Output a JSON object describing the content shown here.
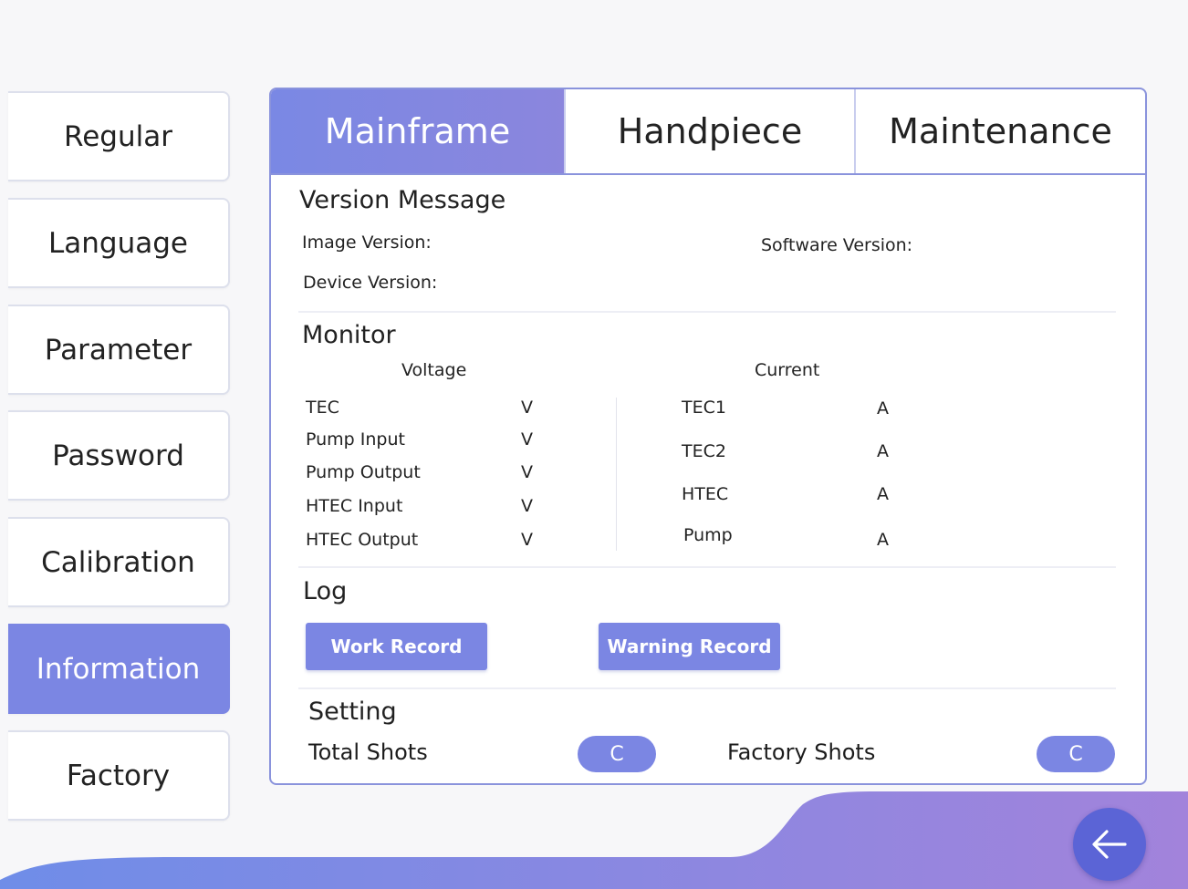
{
  "sidebar": {
    "items": [
      {
        "label": "Regular"
      },
      {
        "label": "Language"
      },
      {
        "label": "Parameter"
      },
      {
        "label": "Password"
      },
      {
        "label": "Calibration"
      },
      {
        "label": "Information"
      },
      {
        "label": "Factory"
      }
    ],
    "active": "Information"
  },
  "tabs": [
    {
      "label": "Mainframe"
    },
    {
      "label": "Handpiece"
    },
    {
      "label": "Maintenance"
    }
  ],
  "version": {
    "title": "Version Message",
    "image_label": "Image Version:",
    "software_label": "Software Version:",
    "device_label": "Device Version:"
  },
  "monitor": {
    "title": "Monitor",
    "voltage_header": "Voltage",
    "current_header": "Current",
    "voltage_rows": [
      {
        "label": "TEC",
        "unit": "V"
      },
      {
        "label": "Pump Input",
        "unit": "V"
      },
      {
        "label": "Pump Output",
        "unit": "V"
      },
      {
        "label": "HTEC Input",
        "unit": "V"
      },
      {
        "label": "HTEC Output",
        "unit": "V"
      }
    ],
    "current_rows": [
      {
        "label": "TEC1",
        "unit": "A"
      },
      {
        "label": "TEC2",
        "unit": "A"
      },
      {
        "label": "HTEC",
        "unit": "A"
      },
      {
        "label": "Pump",
        "unit": "A"
      }
    ]
  },
  "log": {
    "title": "Log",
    "work_record": "Work Record",
    "warning_record": "Warning Record"
  },
  "setting": {
    "title": "Setting",
    "total_shots": "Total Shots",
    "factory_shots": "Factory Shots",
    "clear_label": "C"
  },
  "colors": {
    "accent": "#7b86e3",
    "back_button": "#5b64d6",
    "wave_start": "#6f8de8",
    "wave_end": "#a283db"
  },
  "icons": {
    "back": "arrow-left-icon"
  }
}
